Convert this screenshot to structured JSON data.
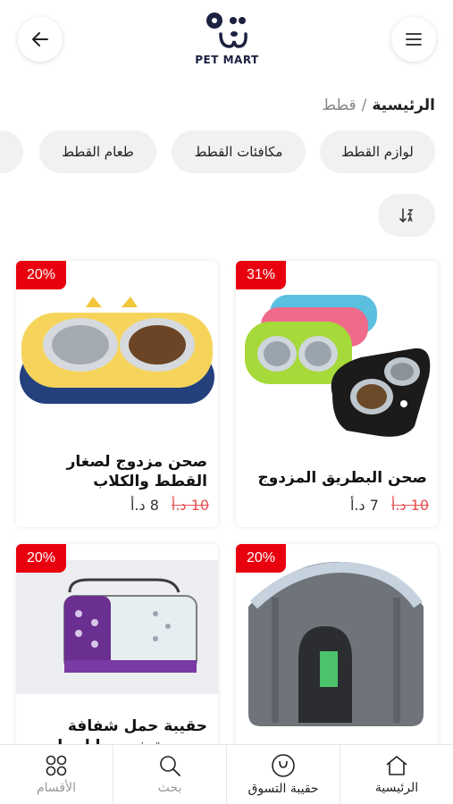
{
  "header": {
    "logo_text": "PET MART",
    "back_icon": "arrow-left-icon",
    "menu_icon": "hamburger-menu-icon"
  },
  "breadcrumb": {
    "home": "الرئيسية",
    "separator": "/",
    "current": "قطط"
  },
  "categories": [
    {
      "label": "لوازم القطط"
    },
    {
      "label": "مكافئات القطط"
    },
    {
      "label": "طعام القطط"
    }
  ],
  "sort_icon": "sort-icon",
  "products": [
    {
      "discount": "31%",
      "title": "صحن البطريق المزدوج",
      "old_price": "10 د.أ",
      "new_price": "7 د.أ"
    },
    {
      "discount": "20%",
      "title": "صحن مزدوج لصغار القطط والكلاب",
      "old_price": "10 د.أ",
      "new_price": "8 د.أ"
    },
    {
      "discount": "20%",
      "title": "",
      "old_price": "",
      "new_price": ""
    },
    {
      "discount": "20%",
      "title": "حقيبة حمل شفافة مصممة خصيصا لحمل القطط",
      "old_price": "",
      "new_price": ""
    }
  ],
  "bottom_nav": [
    {
      "label": "الرئيسية",
      "icon": "home-icon"
    },
    {
      "label": "حقيبة التسوق",
      "icon": "shopping-bag-icon"
    },
    {
      "label": "بحث",
      "icon": "search-icon"
    },
    {
      "label": "الأقسام",
      "icon": "categories-icon"
    }
  ],
  "colors": {
    "discount_badge": "#e8000f",
    "old_price": "#e85050",
    "logo": "#1c2140"
  }
}
